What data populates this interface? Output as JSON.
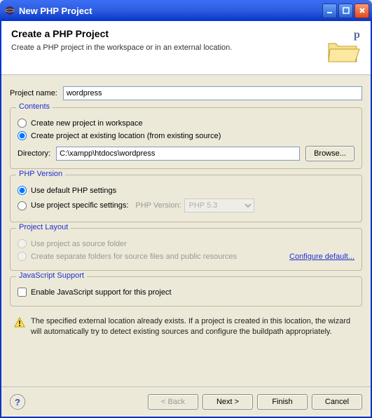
{
  "titlebar": {
    "title": "New PHP Project"
  },
  "header": {
    "title": "Create a PHP Project",
    "subtitle": "Create a PHP project in the workspace or in an external location."
  },
  "project_name": {
    "label": "Project name:",
    "value": "wordpress"
  },
  "contents": {
    "title": "Contents",
    "opt_workspace": "Create new project in workspace",
    "opt_existing": "Create project at existing location (from existing source)",
    "directory_label": "Directory:",
    "directory_value": "C:\\xampp\\htdocs\\wordpress",
    "browse_label": "Browse..."
  },
  "php_version": {
    "title": "PHP Version",
    "opt_default": "Use default PHP settings",
    "opt_specific": "Use project specific settings:",
    "php_version_label": "PHP Version:",
    "php_version_value": "PHP 5.3"
  },
  "layout": {
    "title": "Project Layout",
    "opt_source": "Use project as source folder",
    "opt_separate": "Create separate folders for source files and public resources",
    "configure_link": "Configure default..."
  },
  "js_support": {
    "title": "JavaScript Support",
    "checkbox_label": "Enable JavaScript support for this project"
  },
  "note_text": "The specified external location already exists. If a project is created in this location, the wizard will automatically try to detect existing sources and configure the buildpath appropriately.",
  "footer": {
    "back": "< Back",
    "next": "Next >",
    "finish": "Finish",
    "cancel": "Cancel"
  }
}
